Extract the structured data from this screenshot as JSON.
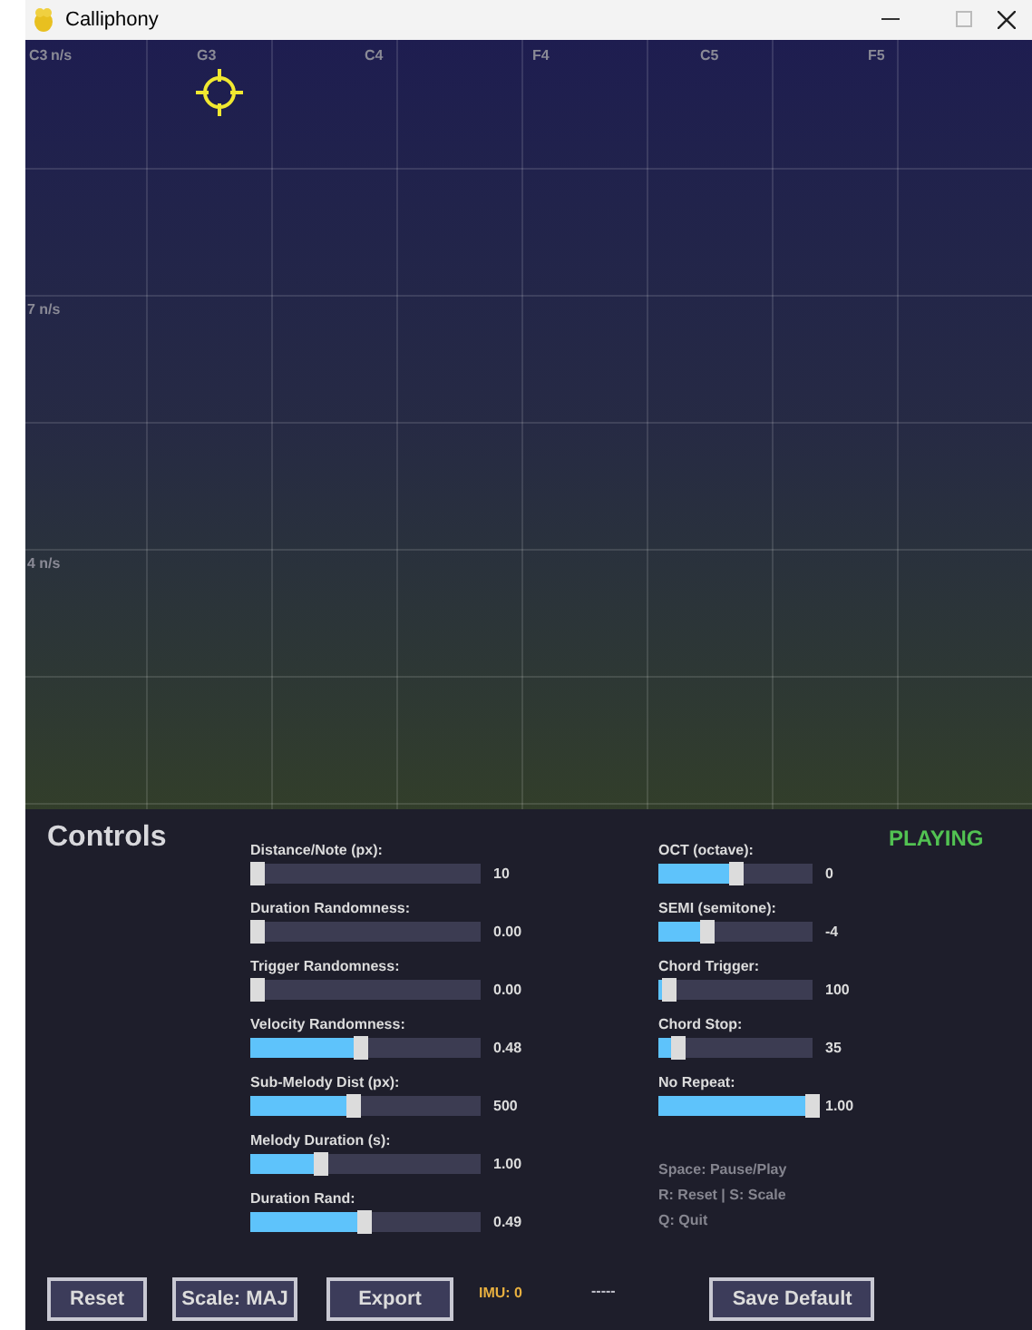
{
  "window": {
    "title": "Calliphony"
  },
  "canvas": {
    "note_labels": [
      "C3",
      "G3",
      "C4",
      "F4",
      "C5",
      "F5"
    ],
    "speed_labels": [
      "n/s",
      "7 n/s",
      "4 n/s"
    ]
  },
  "controls": {
    "title": "Controls",
    "status": "PLAYING",
    "left_sliders": [
      {
        "label": "Distance/Note (px):",
        "value": "10",
        "level": 0
      },
      {
        "label": "Duration Randomness:",
        "value": "0.00",
        "level": 0
      },
      {
        "label": "Trigger Randomness:",
        "value": "0.00",
        "level": 0
      },
      {
        "label": "Velocity Randomness:",
        "value": "0.48",
        "level": 0.48
      },
      {
        "label": "Sub-Melody Dist (px):",
        "value": "500",
        "level": 0.445
      },
      {
        "label": "Melody Duration (s):",
        "value": "1.00",
        "level": 0.305
      },
      {
        "label": "Duration Rand:",
        "value": "0.49",
        "level": 0.495
      }
    ],
    "right_sliders": [
      {
        "label": "OCT (octave):",
        "value": "0",
        "level": 0.5
      },
      {
        "label": "SEMI (semitone):",
        "value": "-4",
        "level": 0.32
      },
      {
        "label": "Chord Trigger:",
        "value": "100",
        "level": 0.07
      },
      {
        "label": "Chord Stop:",
        "value": "35",
        "level": 0.13
      },
      {
        "label": "No Repeat:",
        "value": "1.00",
        "level": 1
      }
    ],
    "shortcuts": [
      "Space: Pause/Play",
      "R: Reset | S: Scale",
      "Q: Quit"
    ]
  },
  "bottom_bar": {
    "buttons": [
      "Reset",
      "Scale: MAJ",
      "Export"
    ],
    "imu": "IMU: 0",
    "indicator": "-----",
    "save_button": "Save Default"
  }
}
